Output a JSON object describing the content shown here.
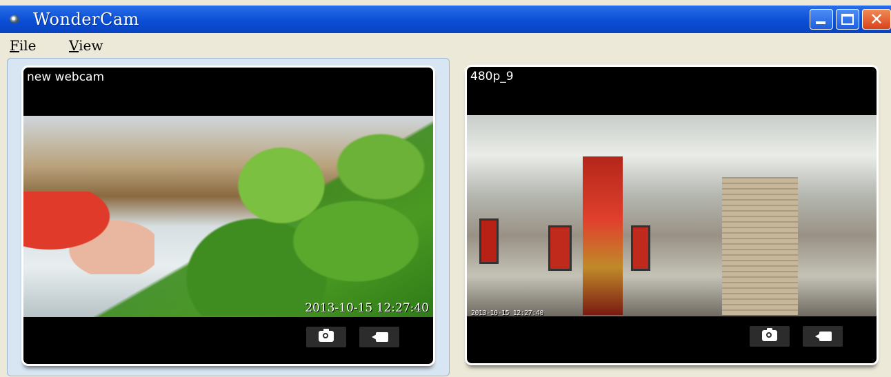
{
  "window": {
    "title": "WonderCam"
  },
  "menu": {
    "items": [
      {
        "label": "File"
      },
      {
        "label": "View"
      }
    ]
  },
  "cameras": [
    {
      "name": "new webcam",
      "timestamp": "2013-10-15 12:27:40"
    },
    {
      "name": "480p_9",
      "timestamp": "2013-10-15 12:27:40"
    }
  ],
  "colors": {
    "titlebar": "#0a4fd6",
    "selected_pane": "#d8e6f3",
    "window_bg": "#ece9d8",
    "close_button": "#d9421c"
  },
  "icons": {
    "snapshot": "camera-icon",
    "record": "video-camera-icon"
  }
}
